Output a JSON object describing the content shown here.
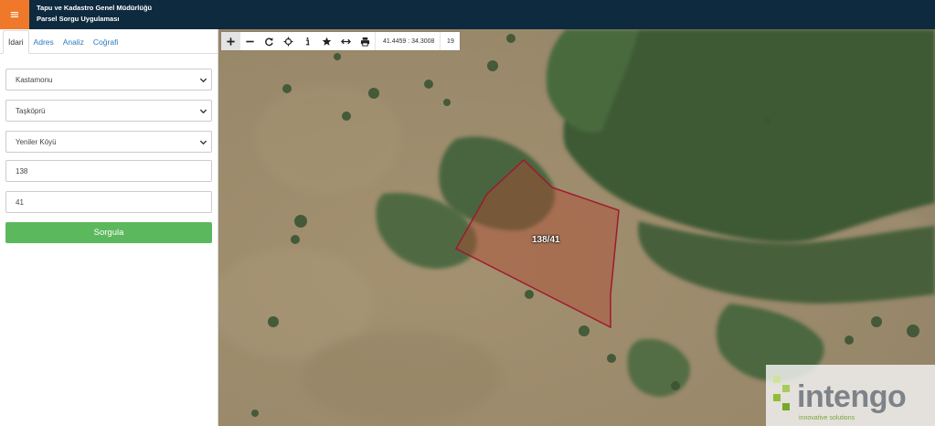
{
  "header": {
    "menu_icon": "≡",
    "title_line1": "Tapu ve Kadastro Genel Müdürlüğü",
    "title_line2": "Parsel Sorgu Uygulaması",
    "bg_color": "#0e2a3f",
    "menu_color": "#f0782a"
  },
  "sidebar": {
    "tabs": [
      {
        "label": "İdari",
        "active": true
      },
      {
        "label": "Adres",
        "active": false
      },
      {
        "label": "Analiz",
        "active": false
      },
      {
        "label": "Coğrafi",
        "active": false
      }
    ],
    "form": {
      "il": "Kastamonu",
      "ilce": "Taşköprü",
      "mahalle": "Yeniler Köyü",
      "ada": "138",
      "parsel": "41"
    },
    "query_button": "Sorgula",
    "button_color": "#5cb85c"
  },
  "map": {
    "toolbar_icons": [
      "plus-icon",
      "minus-icon",
      "refresh-icon",
      "locate-icon",
      "info-icon",
      "star-icon",
      "measure-icon",
      "print-icon"
    ],
    "coordinates": "41.4459 : 34.3008",
    "zoom_level": "19",
    "parcel_label": "138/41",
    "parcel_outline_color": "#9e1a2e"
  },
  "watermark": {
    "brand": "intengo",
    "tagline": "innovative solutions"
  }
}
